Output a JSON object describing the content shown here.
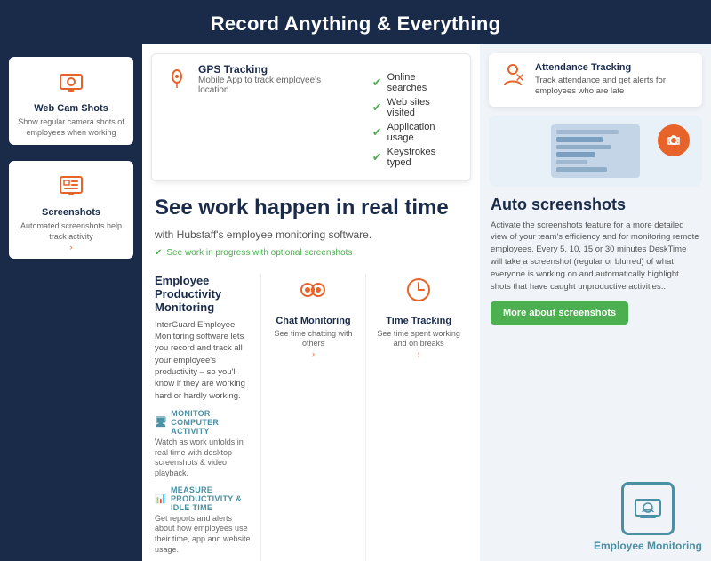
{
  "header": {
    "title": "Record Anything & Everything"
  },
  "left_col": {
    "webcam": {
      "title": "Web Cam Shots",
      "description": "Show regular camera shots of employees when working"
    },
    "screenshots": {
      "title": "Screenshots",
      "description": "Automated screenshots help track activity",
      "link": "›"
    }
  },
  "mid_col": {
    "gps": {
      "title": "GPS Tracking",
      "description": "Mobile App to track employee's location"
    },
    "checklist": [
      "Online searches",
      "Web sites visited",
      "Application usage",
      "Keystrokes typed"
    ],
    "hero": {
      "heading": "See work happen in real time",
      "subtext": "with Hubstaff's employee monitoring software.",
      "note": "See work in progress with optional screenshots"
    },
    "employee_productivity": {
      "title": "Employee Productivity Monitoring",
      "description": "InterGuard Employee Monitoring software lets you record and track all your employee's productivity – so you'll know if they are working hard or hardly working.",
      "monitor_computer": {
        "title": "MONITOR COMPUTER ACTIVITY",
        "description": "Watch as work unfolds in real time with desktop screenshots & video playback."
      },
      "measure_productivity": {
        "title": "MEASURE PRODUCTIVITY & IDLE TIME",
        "description": "Get reports and alerts about how employees use their time, app and website usage."
      }
    },
    "chat_monitoring": {
      "title": "Chat Monitoring",
      "description": "See time chatting with others",
      "link": "›"
    },
    "time_tracking": {
      "title": "Time Tracking",
      "description": "See time spent working and on breaks",
      "link": "›"
    }
  },
  "right_col": {
    "attendance": {
      "title": "Attendance Tracking",
      "description": "Track attendance and get alerts for employees who are late"
    },
    "auto_screenshots": {
      "title": "Auto screenshots",
      "description": "Activate the screenshots feature for a more detailed view of your team's efficiency and for monitoring remote employees. Every 5, 10, 15 or 30 minutes DeskTime will take a screenshot (regular or blurred) of what everyone is working on and automatically highlight shots that have caught unproductive activities..",
      "button": "More about screenshots"
    },
    "employee_monitoring": {
      "title": "Employee Monitoring"
    }
  },
  "icons": {
    "check": "✔",
    "webcam": "📷",
    "screenshot": "🖥",
    "gps": "📍",
    "chat": "💬",
    "clock": "⏱",
    "attendance": "🏃",
    "camera_circle": "📸",
    "monitor": "🖥",
    "shield": "🛡",
    "computer": "🖥",
    "productivity": "📊"
  },
  "colors": {
    "accent_orange": "#e8632a",
    "accent_green": "#4caf50",
    "dark_blue": "#1a2b4a",
    "teal": "#4a90a4",
    "light_bg": "#f0f4f8"
  }
}
